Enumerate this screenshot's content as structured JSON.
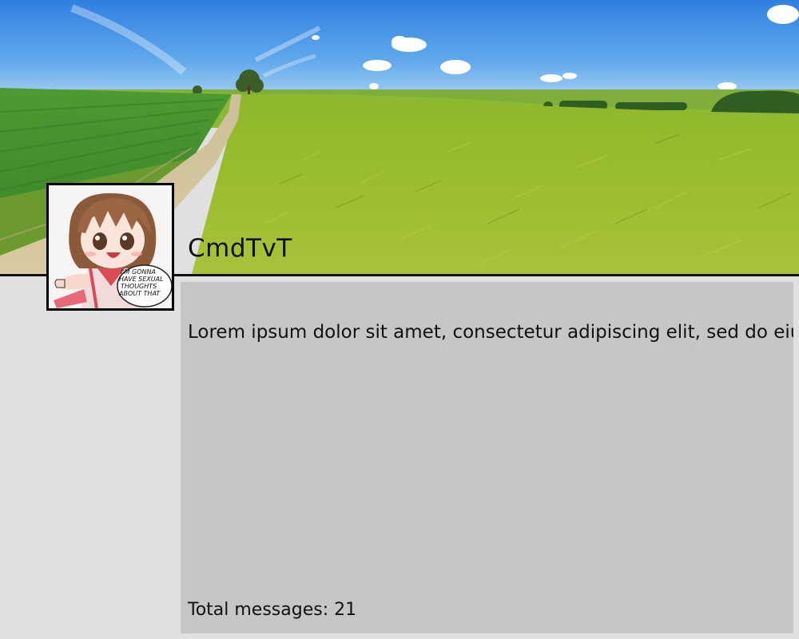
{
  "profile": {
    "username": "CmdTvT",
    "bio": "Lorem ipsum dolor sit amet, consectetur adipiscing elit, sed do eiusmod tempor incididunt ut labore et dolore magna aliqua.",
    "total_messages_label": "Total messages:",
    "total_messages_count": "21"
  },
  "avatar": {
    "speech_bubble": [
      "I'M GONNA",
      "HAVE SEXUAL",
      "THOUGHTS",
      "ABOUT THAT"
    ]
  },
  "colors": {
    "page_background": "#e0e0e0",
    "card_background": "#c6c6c6",
    "text": "#111111",
    "sky": "#3f8ee0",
    "field": "#8db52a"
  },
  "icons": {
    "banner": "landscape-banner-image",
    "avatar": "avatar-image"
  }
}
